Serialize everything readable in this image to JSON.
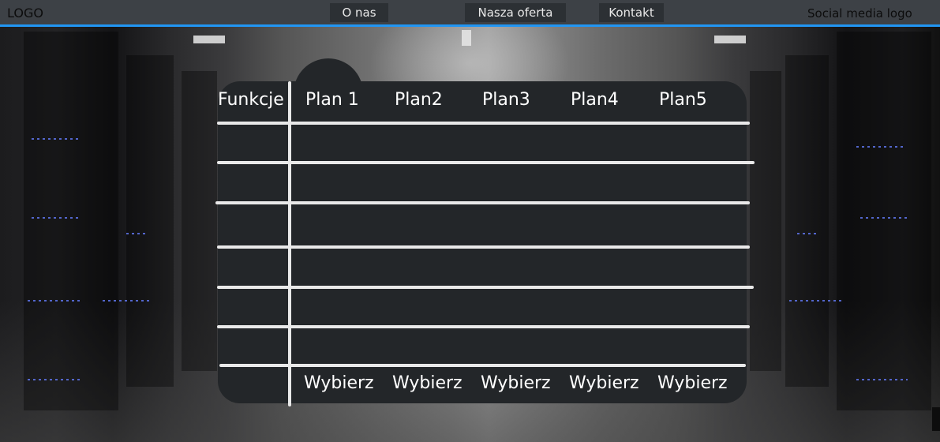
{
  "header": {
    "logo": "LOGO",
    "nav": [
      "O nas",
      "Nasza oferta",
      "Kontakt"
    ],
    "social": "Social media logo",
    "accent_color": "#2196f3"
  },
  "table": {
    "corner_header": "Funkcje",
    "plans": [
      "Plan 1",
      "Plan2",
      "Plan3",
      "Plan4",
      "Plan5"
    ],
    "choose_label": "Wybierz",
    "background_color": "#232629",
    "line_color": "#e9e9e9"
  }
}
